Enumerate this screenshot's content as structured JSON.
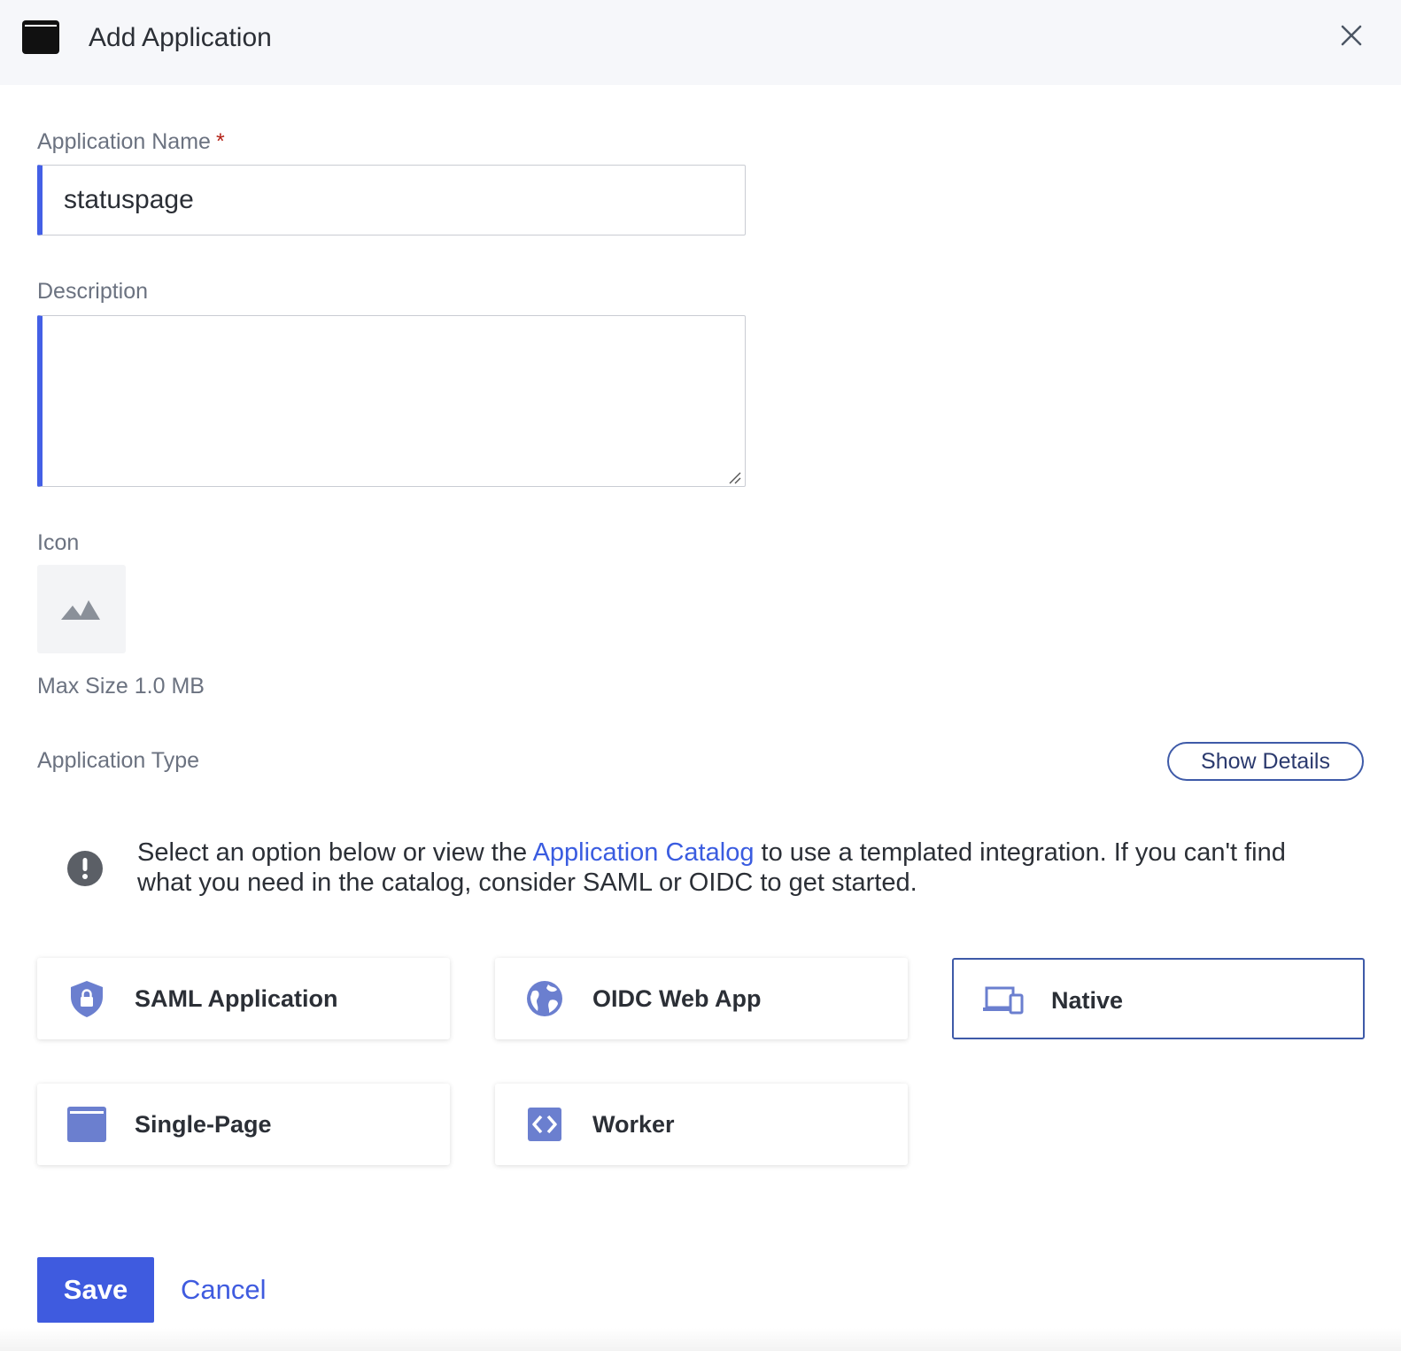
{
  "header": {
    "title": "Add Application",
    "app_icon": "browser-window-icon",
    "close_icon": "close-icon"
  },
  "form": {
    "name_label": "Application Name",
    "required_marker": "*",
    "name_value": "statuspage",
    "description_label": "Description",
    "description_value": "",
    "icon_label": "Icon",
    "icon_placeholder": "image-placeholder-icon",
    "max_size": "Max Size 1.0 MB",
    "type_label": "Application Type",
    "show_details": "Show Details"
  },
  "info": {
    "icon": "exclamation-circle-icon",
    "text_before": "Select an option below or view the ",
    "link": "Application Catalog",
    "text_after": " to use a templated integration. If you can't find what you need in the catalog, consider SAML or OIDC to get started."
  },
  "app_types": [
    {
      "label": "SAML Application",
      "icon": "shield-lock-icon",
      "selected": false
    },
    {
      "label": "OIDC Web App",
      "icon": "globe-icon",
      "selected": false
    },
    {
      "label": "Native",
      "icon": "devices-icon",
      "selected": true
    },
    {
      "label": "Single-Page",
      "icon": "browser-window-icon",
      "selected": false
    },
    {
      "label": "Worker",
      "icon": "code-brackets-icon",
      "selected": false
    }
  ],
  "footer": {
    "save": "Save",
    "cancel": "Cancel"
  },
  "colors": {
    "accent": "#3f5bdf",
    "selected_border": "#3e5aa8",
    "icon_tint": "#6b7fcf",
    "header_bg": "#f6f7fa"
  }
}
